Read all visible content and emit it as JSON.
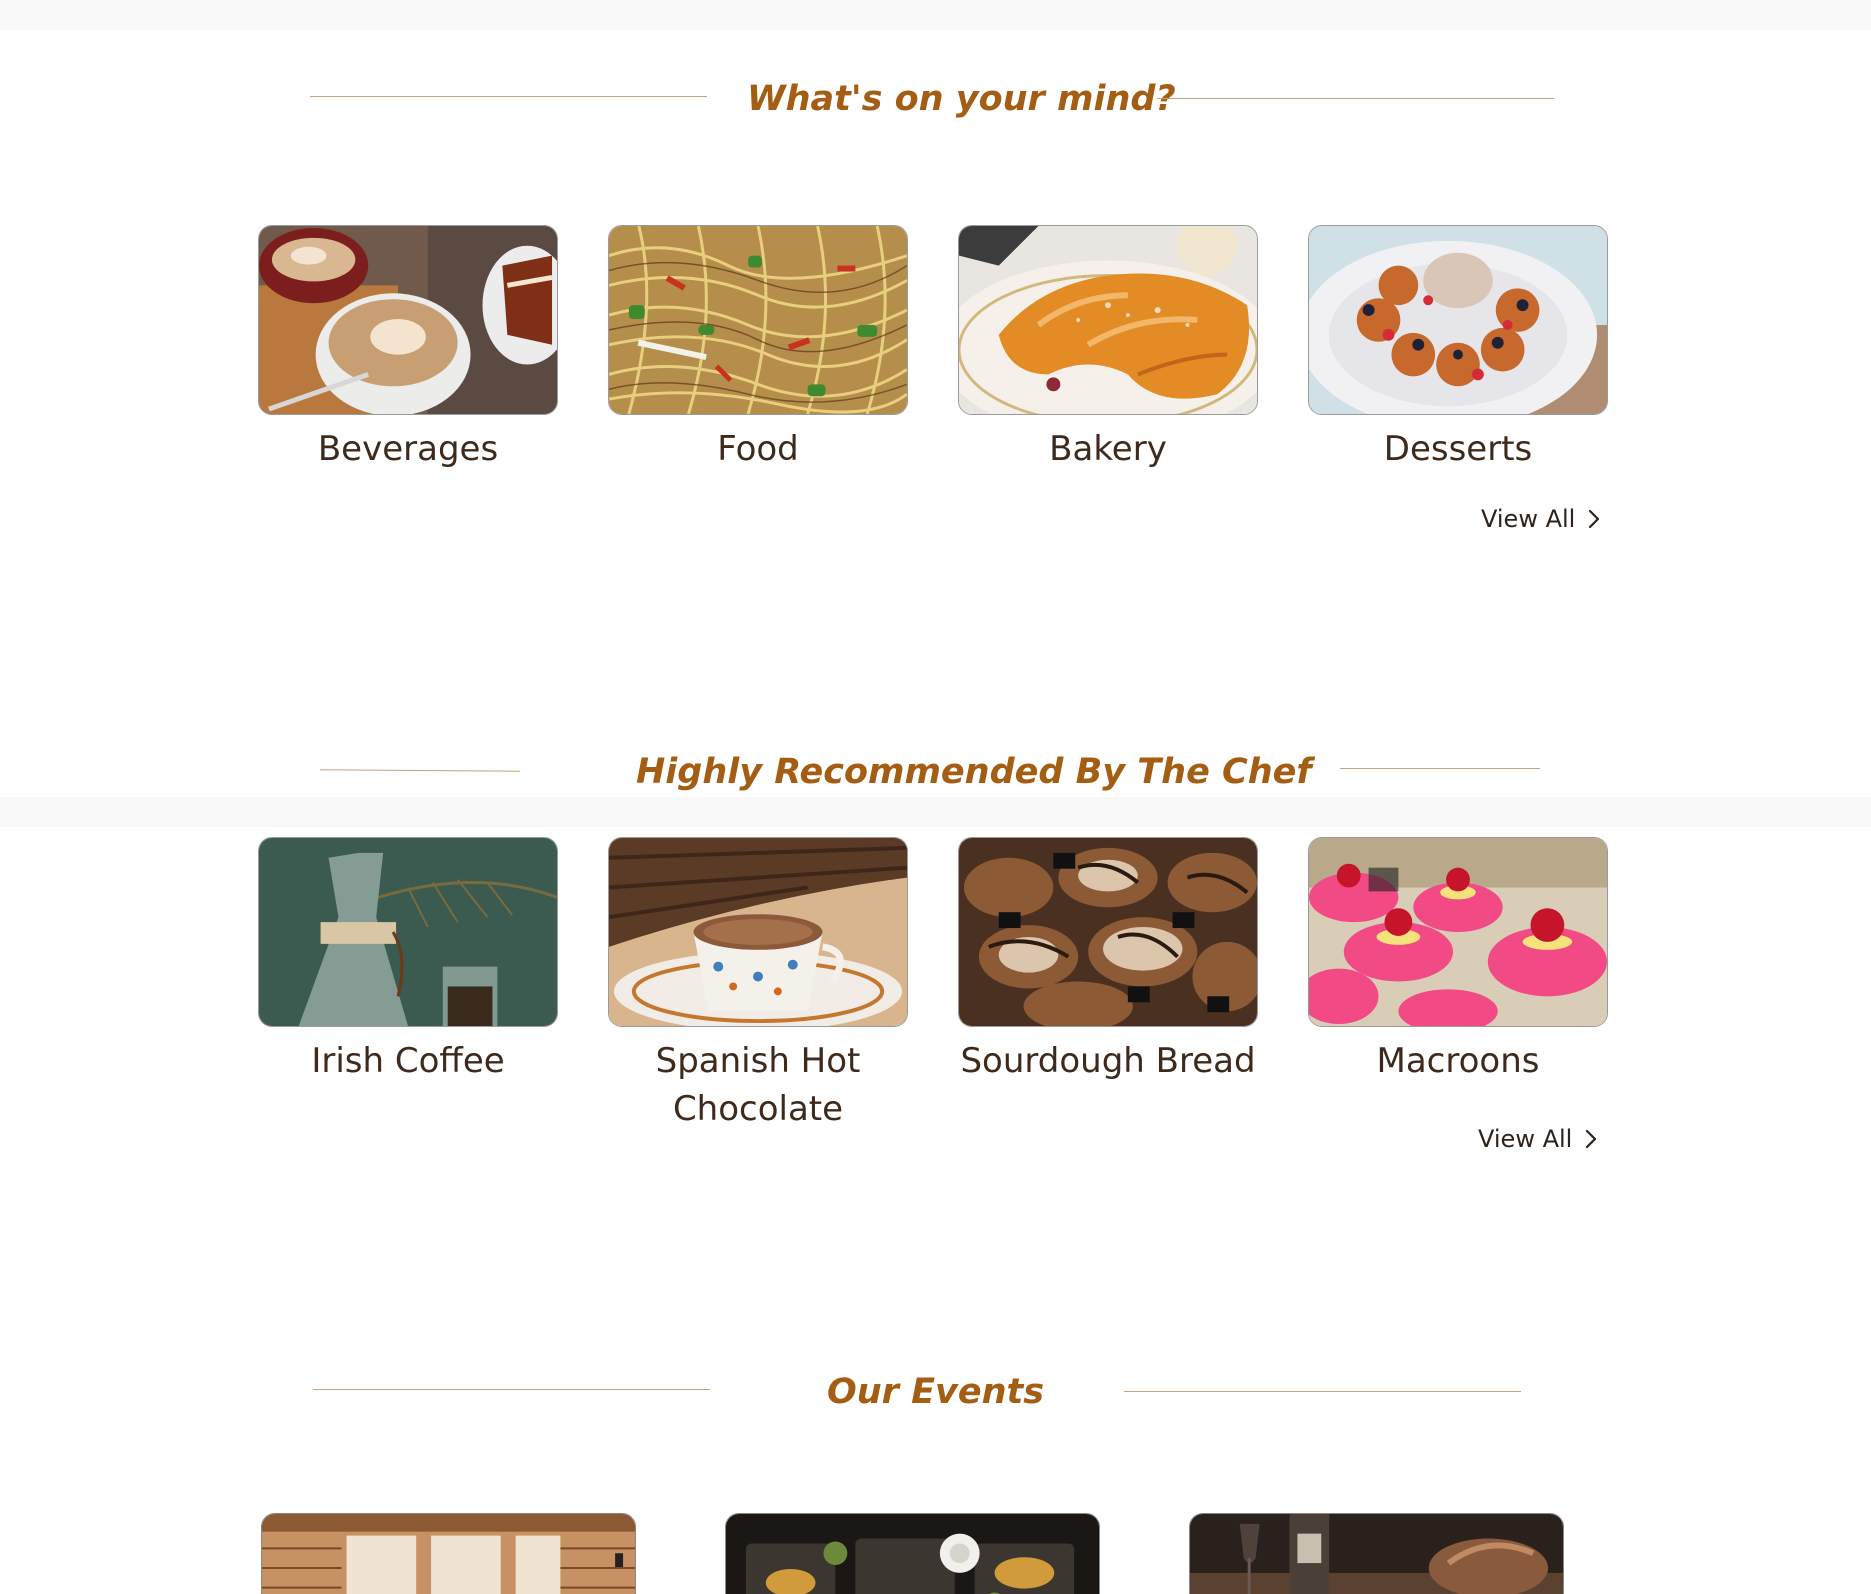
{
  "sections": {
    "categories": {
      "title": "What's on your mind?",
      "items": [
        {
          "label": "Beverages",
          "image": "latte-cups-image"
        },
        {
          "label": "Food",
          "image": "noodles-image"
        },
        {
          "label": "Bakery",
          "image": "croissant-image"
        },
        {
          "label": "Desserts",
          "image": "dessert-plate-image"
        }
      ],
      "view_all": "View All"
    },
    "chef": {
      "title": "Highly Recommended By The Chef",
      "items": [
        {
          "label": "Irish Coffee",
          "image": "coffee-carafe-image"
        },
        {
          "label": "Spanish Hot Chocolate",
          "image": "hot-chocolate-image"
        },
        {
          "label": "Sourdough Bread",
          "image": "breads-image"
        },
        {
          "label": "Macroons",
          "image": "macarons-image"
        }
      ],
      "view_all": "View All"
    },
    "events": {
      "title": "Our Events",
      "items": [
        {
          "image": "cafe-interior-image"
        },
        {
          "image": "dining-table-image"
        },
        {
          "image": "wine-dinner-image"
        }
      ]
    }
  },
  "colors": {
    "heading": "#a35e14",
    "text": "#3d2a1c",
    "rule": "#c9a27a",
    "band": "#f9f9f9"
  },
  "icons": {
    "view_all": "chevron-right-icon"
  }
}
